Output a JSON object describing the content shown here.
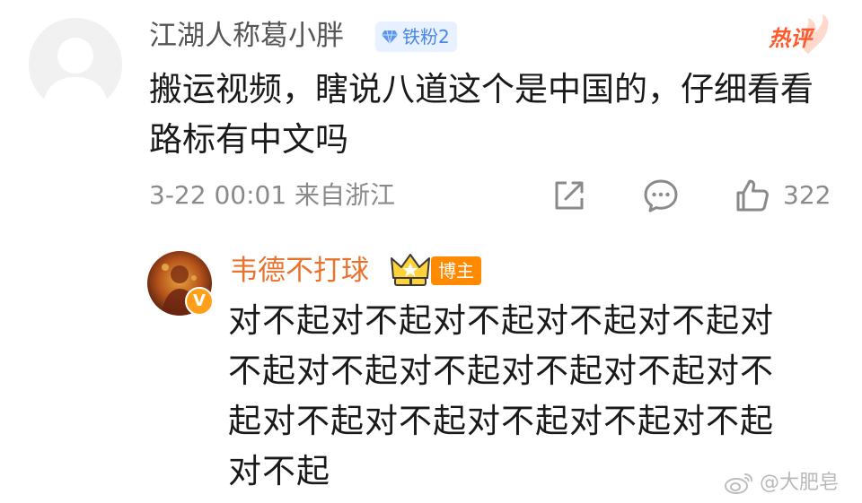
{
  "top_comment": {
    "username": "江湖人称葛小胖",
    "fan_badge": "铁粉2",
    "hot_tag": "热评",
    "text": "搬运视频，瞎说八道这个是中国的，仔细看看路标有中文吗",
    "meta": "3-22 00:01 来自浙江",
    "like_count": "322",
    "icons": [
      "share-icon",
      "comment-icon",
      "like-icon"
    ]
  },
  "reply": {
    "username": "韦德不打球",
    "role_badge": "博主",
    "verified_mark": "V",
    "text": "对不起对不起对不起对不起对不起对不起对不起对不起对不起对不起对不起对不起对不起对不起对不起对不起对不起"
  },
  "watermark": {
    "text": "@大肥皂"
  },
  "colors": {
    "reply_name": "#e8732f",
    "fan_badge_bg": "#e8f1ff",
    "fan_badge_text": "#4a86e8",
    "hot": "#ff5a2e",
    "blogger_badge_bg": "#ff8a00",
    "meta_gray": "#8a8a8a"
  }
}
